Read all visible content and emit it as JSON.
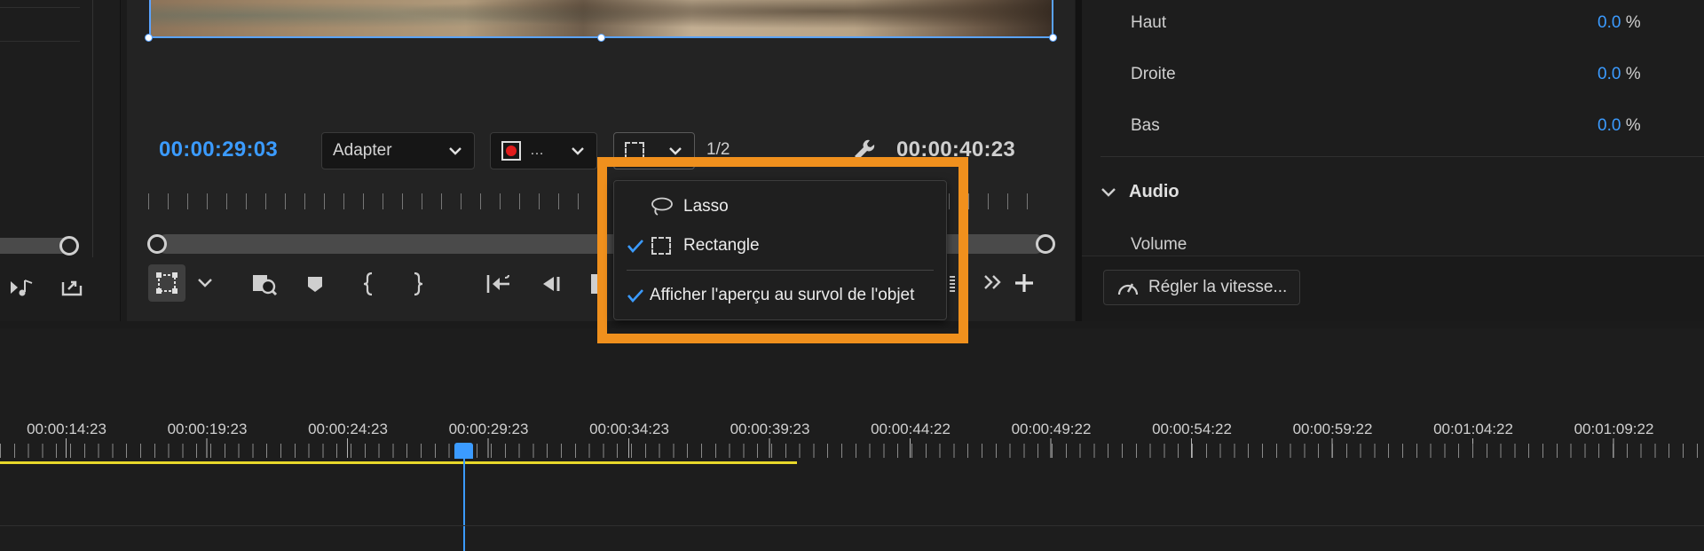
{
  "monitor": {
    "current_timecode": "00:00:29:03",
    "duration_timecode": "00:00:40:23",
    "zoom_select": "Adapter",
    "quality_select": "1/2"
  },
  "mask_menu": {
    "items": [
      {
        "label": "Lasso",
        "checked": false,
        "icon": "lasso-icon"
      },
      {
        "label": "Rectangle",
        "checked": true,
        "icon": "rectangle-select-icon"
      },
      {
        "label": "Afficher l'aperçu au survol de l'objet",
        "checked": true,
        "icon": ""
      }
    ]
  },
  "properties": {
    "rows": [
      {
        "label": "Haut",
        "value": "0.0",
        "unit": "%"
      },
      {
        "label": "Droite",
        "value": "0.0",
        "unit": "%"
      },
      {
        "label": "Bas",
        "value": "0.0",
        "unit": "%"
      }
    ],
    "audio_section": "Audio",
    "volume_label": "Volume",
    "speed_button": "Régler la vitesse..."
  },
  "timeline": {
    "ruler_labels": [
      "00:00:14:23",
      "00:00:19:23",
      "00:00:24:23",
      "00:00:29:23",
      "00:00:34:23",
      "00:00:39:23",
      "00:00:44:22",
      "00:00:49:22",
      "00:00:54:22",
      "00:00:59:22",
      "00:01:04:22",
      "00:01:09:22"
    ]
  },
  "colors": {
    "accent_blue": "#3b9bff",
    "highlight_orange": "#f0901d",
    "work_area_yellow": "#e8d82a"
  }
}
